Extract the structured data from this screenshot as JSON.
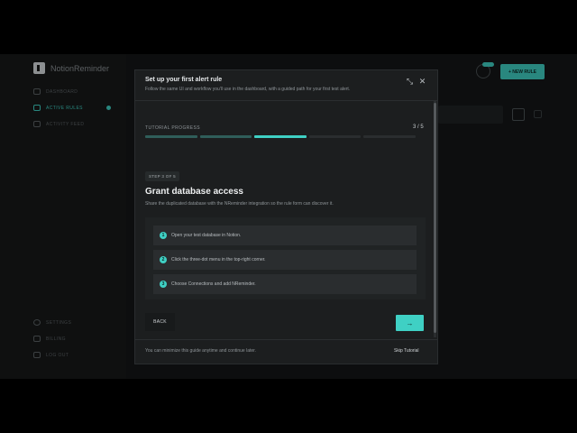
{
  "app": {
    "brand_name": "NotionReminder",
    "colors": {
      "accent": "#3fd0c4",
      "background": "#141617",
      "modal": "#1c1e1f"
    }
  },
  "sidebar": {
    "items": [
      {
        "label": "DASHBOARD",
        "icon": "grid-icon"
      },
      {
        "label": "ACTIVE RULES",
        "icon": "rules-icon",
        "active": true
      },
      {
        "label": "ACTIVITY FEED",
        "icon": "activity-icon"
      }
    ],
    "bottom_items": [
      {
        "label": "SETTINGS",
        "icon": "gear-icon"
      },
      {
        "label": "BILLING",
        "icon": "card-icon"
      },
      {
        "label": "LOG OUT",
        "icon": "logout-icon"
      }
    ]
  },
  "header": {
    "new_rule_label": "+ NEW RULE"
  },
  "modal": {
    "title": "Set up your first alert rule",
    "subtitle": "Follow the same UI and workflow you'll use in the dashboard, with a guided path for your first test alert.",
    "minimize_icon": "minimize-icon",
    "close_icon": "close-icon",
    "progress_label": "TUTORIAL PROGRESS",
    "progress_count": "3 / 5",
    "progress": {
      "current": 3,
      "total": 5
    },
    "step_pill": "STEP 3 OF 5",
    "step_title": "Grant database access",
    "step_desc": "Share the duplicated database with the NReminder integration so the rule form can discover it.",
    "instructions": [
      {
        "num": "1",
        "text": "Open your test database in Notion."
      },
      {
        "num": "2",
        "text": "Click the three-dot menu in the top-right corner."
      },
      {
        "num": "3",
        "text": "Choose Connections and add NReminder."
      }
    ],
    "back_label": "BACK",
    "next_icon": "arrow-right-icon",
    "footer_note": "You can minimize this guide anytime and continue later.",
    "skip_label": "Skip Tutorial"
  }
}
